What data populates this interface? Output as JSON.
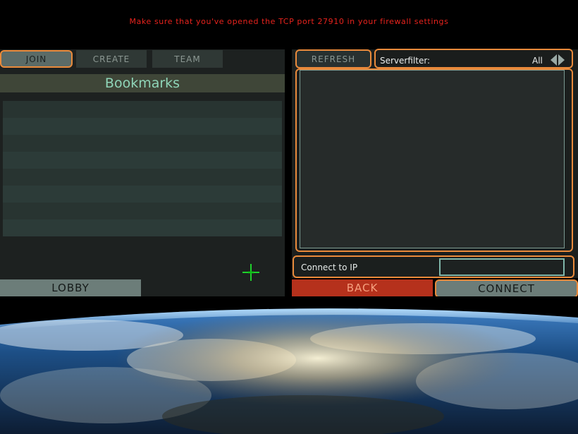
{
  "warning": "Make sure that you've opened the TCP port 27910 in your firewall settings",
  "tabs": [
    {
      "label": "JOIN",
      "active": true
    },
    {
      "label": "CREATE",
      "active": false
    },
    {
      "label": "TEAM",
      "active": false
    }
  ],
  "bookmarks": {
    "title": "Bookmarks",
    "add_icon": "plus-icon",
    "add_icon_color": "#1fd12c"
  },
  "lobby_label": "LOBBY",
  "refresh_label": "REFRESH",
  "serverfilter": {
    "label": "Serverfilter:",
    "value": "All",
    "left_icon": "triangle-left-icon",
    "right_icon": "triangle-right-icon"
  },
  "connect_to_ip": {
    "label": "Connect to IP",
    "value": ""
  },
  "back_label": "BACK",
  "connect_label": "CONNECT",
  "colors": {
    "highlight": "#e98a3b",
    "warning": "#e8231d",
    "back": "#b5311c",
    "accent_text": "#8fd5b8"
  }
}
